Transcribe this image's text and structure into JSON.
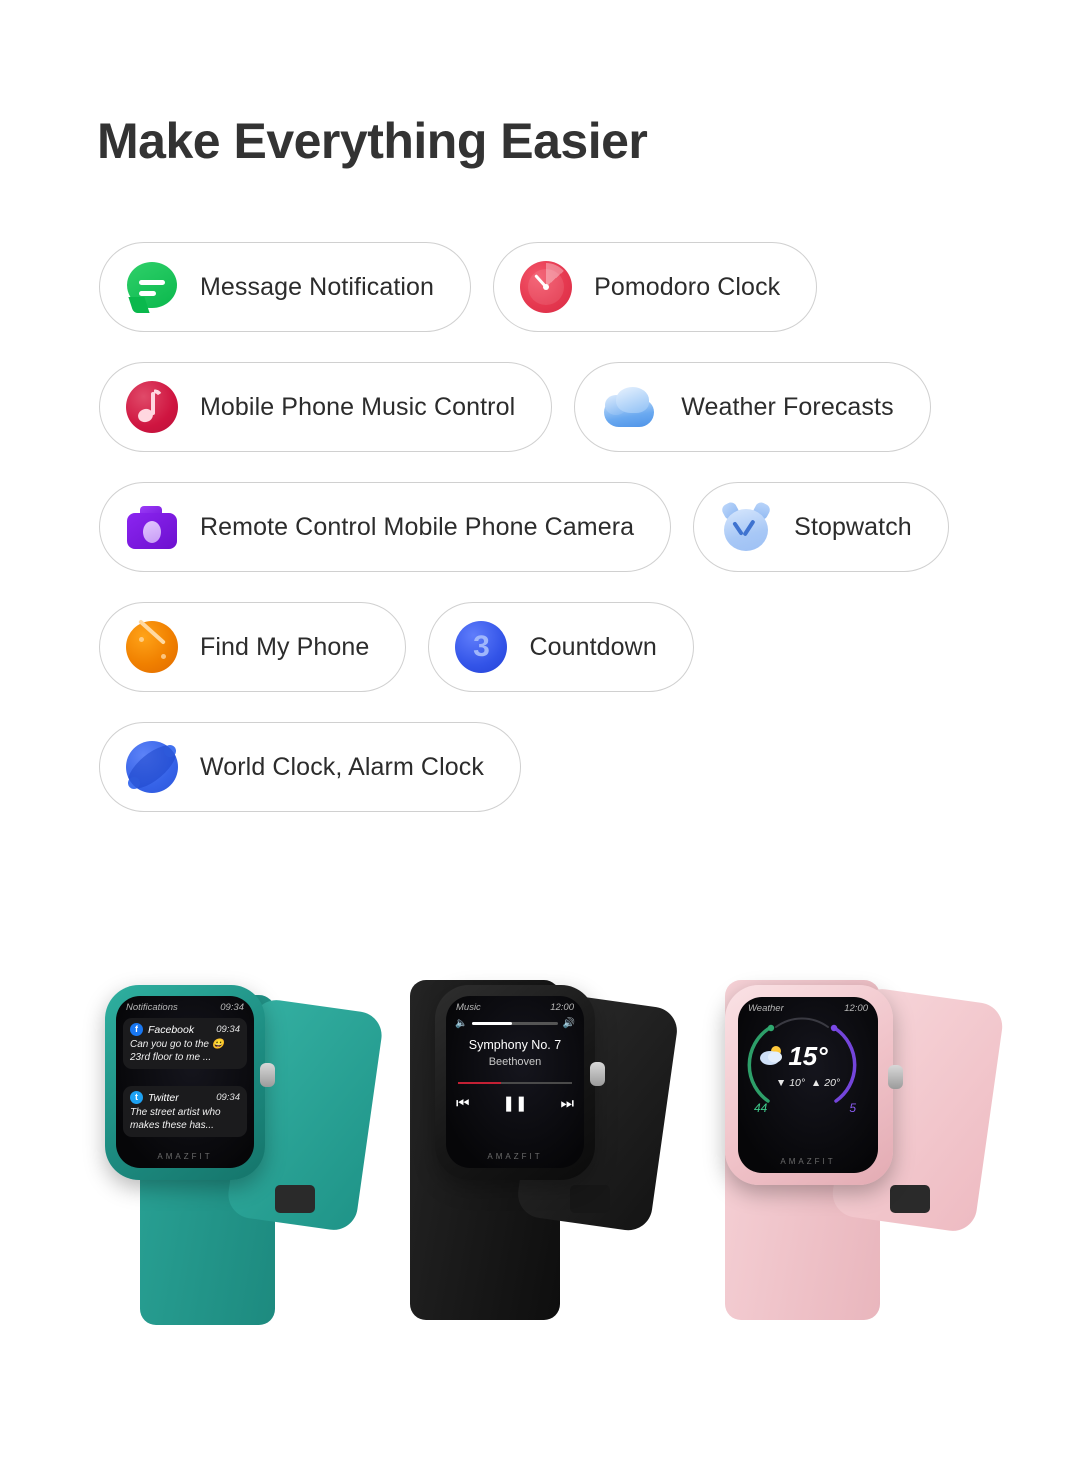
{
  "page": {
    "title": "Make Everything Easier"
  },
  "features": [
    [
      {
        "id": "message-notification",
        "label": "Message Notification",
        "icon": "message-bubble-icon",
        "color": "#0ab84c"
      },
      {
        "id": "pomodoro-clock",
        "label": "Pomodoro Clock",
        "icon": "pomodoro-timer-icon",
        "color": "#e63950"
      }
    ],
    [
      {
        "id": "music-control",
        "label": "Mobile Phone Music Control",
        "icon": "music-note-icon",
        "color": "#cf1540"
      },
      {
        "id": "weather-forecasts",
        "label": "Weather Forecasts",
        "icon": "cloud-icon",
        "color": "#6aa9f0"
      }
    ],
    [
      {
        "id": "remote-camera",
        "label": "Remote Control Mobile Phone Camera",
        "icon": "camera-icon",
        "color": "#7a1ade"
      },
      {
        "id": "stopwatch",
        "label": "Stopwatch",
        "icon": "alarm-clock-icon",
        "color": "#a8c8f6"
      }
    ],
    [
      {
        "id": "find-my-phone",
        "label": "Find My Phone",
        "icon": "radar-icon",
        "color": "#f08000"
      },
      {
        "id": "countdown",
        "label": "Countdown",
        "icon": "countdown-icon",
        "color": "#3354e8",
        "badge": "3"
      }
    ],
    [
      {
        "id": "world-alarm-clock",
        "label": "World Clock, Alarm Clock",
        "icon": "globe-icon",
        "color": "#3663e8"
      }
    ]
  ],
  "watches": [
    {
      "id": "teal-watch",
      "color_name": "teal",
      "case_color": "#1f9488",
      "band_color": "#2aa396",
      "brand": "AMAZFIT",
      "screen": {
        "app": "Notifications",
        "time": "09:34",
        "notifications": [
          {
            "app": "Facebook",
            "time": "09:34",
            "body": "Can you go to the 😀 23rd floor to me ...",
            "icon": "facebook-icon"
          },
          {
            "app": "Twitter",
            "time": "09:34",
            "body": "The street artist who makes these has...",
            "icon": "twitter-icon"
          }
        ]
      }
    },
    {
      "id": "black-watch",
      "color_name": "black",
      "case_color": "#191919",
      "band_color": "#1c1c1c",
      "brand": "AMAZFIT",
      "screen": {
        "app": "Music",
        "time": "12:00",
        "track_title": "Symphony No. 7",
        "artist": "Beethoven",
        "volume_percent": 46,
        "progress_percent": 38,
        "controls": {
          "previous": "⏮",
          "pause": "❚❚",
          "next": "⏭"
        },
        "volume_down_icon": "speaker-minus-icon",
        "volume_up_icon": "speaker-plus-icon"
      }
    },
    {
      "id": "pink-watch",
      "color_name": "pink",
      "case_color": "#f3c7cd",
      "band_color": "#f2c6cc",
      "brand": "AMAZFIT",
      "screen": {
        "app": "Weather",
        "time": "12:00",
        "temperature": "15°",
        "low": "10°",
        "high": "20°",
        "low_icon": "arrow-down-icon",
        "high_icon": "arrow-up-icon",
        "condition_icon": "sun-behind-cloud-icon",
        "left_metric": "44",
        "right_metric": "5",
        "left_arc_color": "#3ec98a",
        "right_arc_color": "#8a5cf0"
      }
    }
  ]
}
